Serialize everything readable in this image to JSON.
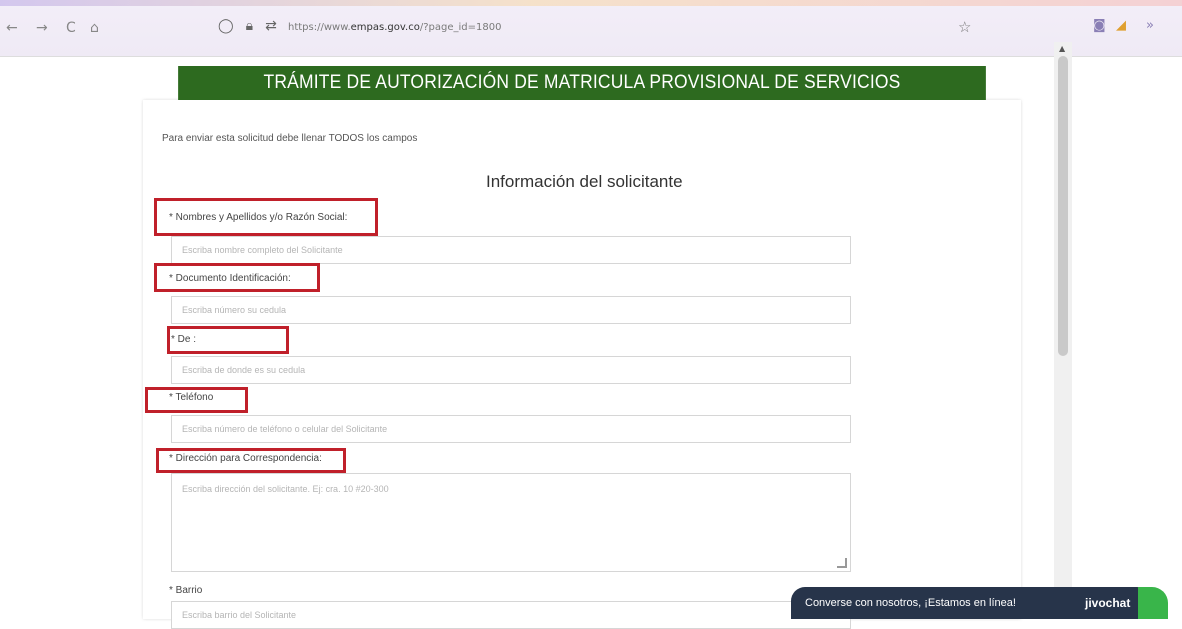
{
  "browser": {
    "back": "←",
    "forward": "→",
    "reload": "C",
    "home": "⌂",
    "url_prefix": "https://www.",
    "url_domain": "empas.gov.co",
    "url_suffix": "/?page_id=1800",
    "star": "☆",
    "ext1": "◙",
    "ext2": "◢",
    "overflow": "»"
  },
  "header": {
    "title": "TRÁMITE DE AUTORIZACIÓN DE MATRICULA PROVISIONAL DE SERVICIOS"
  },
  "intro": "Para enviar esta solicitud debe llenar TODOS los campos",
  "section_title": "Información del solicitante",
  "fields": {
    "nombres": {
      "label": "* Nombres y Apellidos y/o Razón Social:",
      "placeholder": "Escriba nombre completo del Solicitante"
    },
    "documento": {
      "label": "* Documento Identificación:",
      "placeholder": "Escriba número su cedula"
    },
    "de": {
      "label": "* De :",
      "placeholder": "Escriba de donde es su cedula"
    },
    "telefono": {
      "label": "* Teléfono",
      "placeholder": "Escriba número de teléfono o celular del Solicitante"
    },
    "direccion": {
      "label": "* Dirección para Correspondencia:",
      "placeholder": "Escriba dirección del solicitante. Ej: cra. 10 #20-300"
    },
    "barrio": {
      "label": "* Barrio",
      "placeholder": "Escriba barrio del Solicitante"
    }
  },
  "chat": {
    "text": "Converse con nosotros, ¡Estamos en línea!",
    "brand": "jivochat"
  },
  "colors": {
    "header_bg": "#2d6a1f",
    "highlight": "#c0202a",
    "chat_bg": "#27344a",
    "chat_accent": "#39b54a"
  }
}
